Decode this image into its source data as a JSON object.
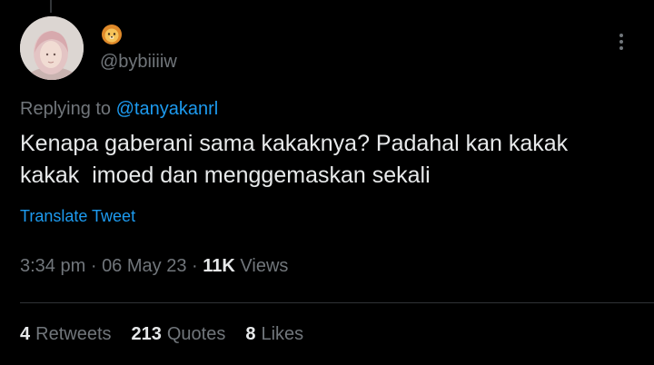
{
  "author": {
    "display_name_icon": "lion-face-icon",
    "handle": "@bybiiiiw",
    "avatar_icon": "profile-avatar"
  },
  "reply": {
    "prefix": "Replying to",
    "mention": "@tanyakanrl"
  },
  "tweet": {
    "text": "Kenapa gaberani sama kakaknya? Padahal kan kakak\nkakak  imoed dan menggemaskan sekali",
    "translate_label": "Translate Tweet"
  },
  "meta": {
    "time": "3:34 pm",
    "separator": "·",
    "date": "06 May 23",
    "views_count": "11K",
    "views_label": "Views"
  },
  "stats": {
    "retweets_count": "4",
    "retweets_label": "Retweets",
    "quotes_count": "213",
    "quotes_label": "Quotes",
    "likes_count": "8",
    "likes_label": "Likes"
  },
  "colors": {
    "background": "#000000",
    "text_primary": "#e7e9ea",
    "text_secondary": "#71767b",
    "link": "#1d9bf0",
    "divider": "#2f3336"
  }
}
